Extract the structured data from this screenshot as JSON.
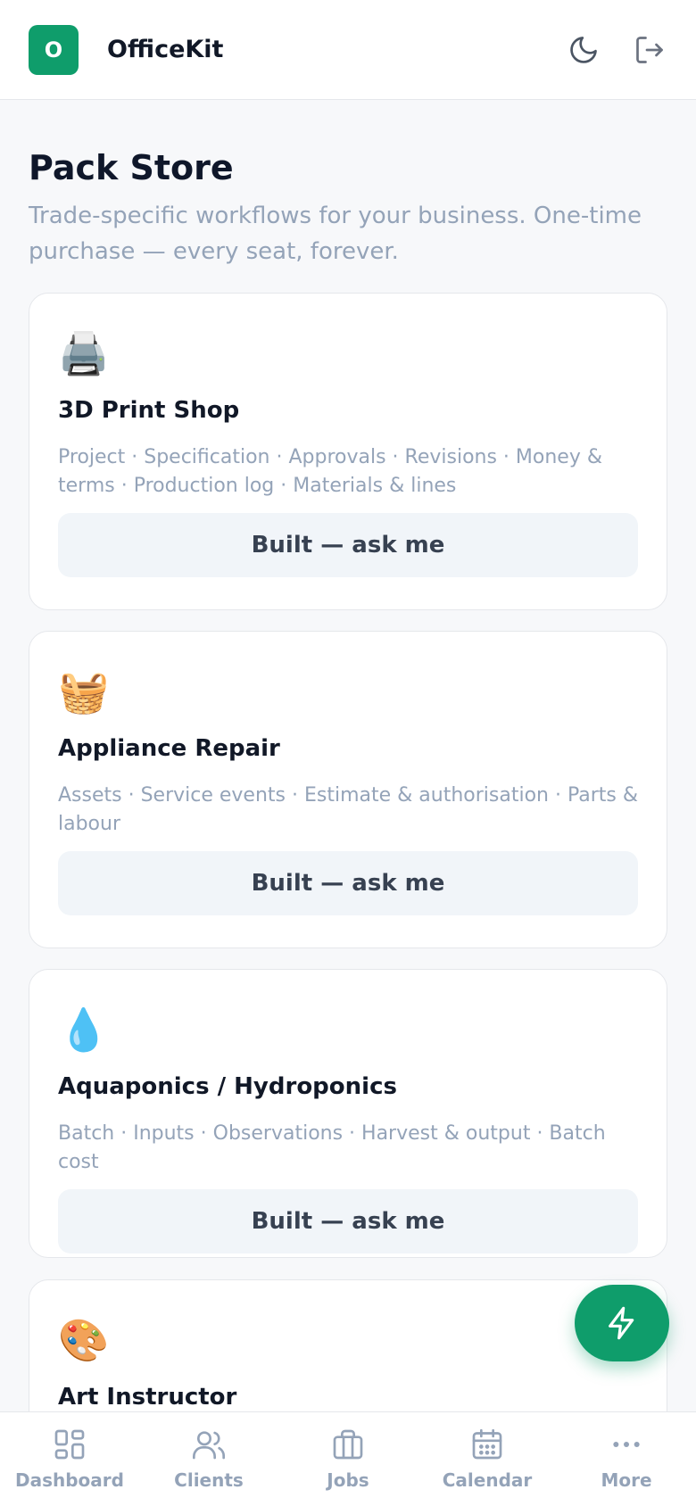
{
  "header": {
    "logo_letter": "O",
    "app_name": "OfficeKit",
    "icons": [
      "moon-icon",
      "logout-icon"
    ]
  },
  "page": {
    "title": "Pack Store",
    "subtitle": "Trade-specific workflows for your business. One-time purchase — every seat, forever."
  },
  "packs": [
    {
      "emoji": "🖨️",
      "title": "3D Print Shop",
      "description": "Project · Specification · Approvals · Revisions · Money & terms · Production log · Materials & lines",
      "button": "Built — ask me"
    },
    {
      "emoji": "🧺",
      "title": "Appliance Repair",
      "description": "Assets · Service events · Estimate & authorisation · Parts & labour",
      "button": "Built — ask me"
    },
    {
      "emoji": "💧",
      "title": "Aquaponics / Hydroponics",
      "description": "Batch · Inputs · Observations · Harvest & output · Batch cost",
      "button": "Built — ask me"
    },
    {
      "emoji": "🎨",
      "title": "Art Instructor",
      "description": "",
      "button": ""
    }
  ],
  "fab": {
    "icon": "lightning-icon"
  },
  "nav": {
    "items": [
      {
        "label": "Dashboard",
        "icon": "dashboard-icon"
      },
      {
        "label": "Clients",
        "icon": "users-icon"
      },
      {
        "label": "Jobs",
        "icon": "briefcase-icon"
      },
      {
        "label": "Calendar",
        "icon": "calendar-icon"
      },
      {
        "label": "More",
        "icon": "more-icon"
      }
    ]
  },
  "colors": {
    "brand": "#0f9d6b",
    "muted_text": "#94a3b8",
    "button_bg": "#f1f5f9"
  }
}
